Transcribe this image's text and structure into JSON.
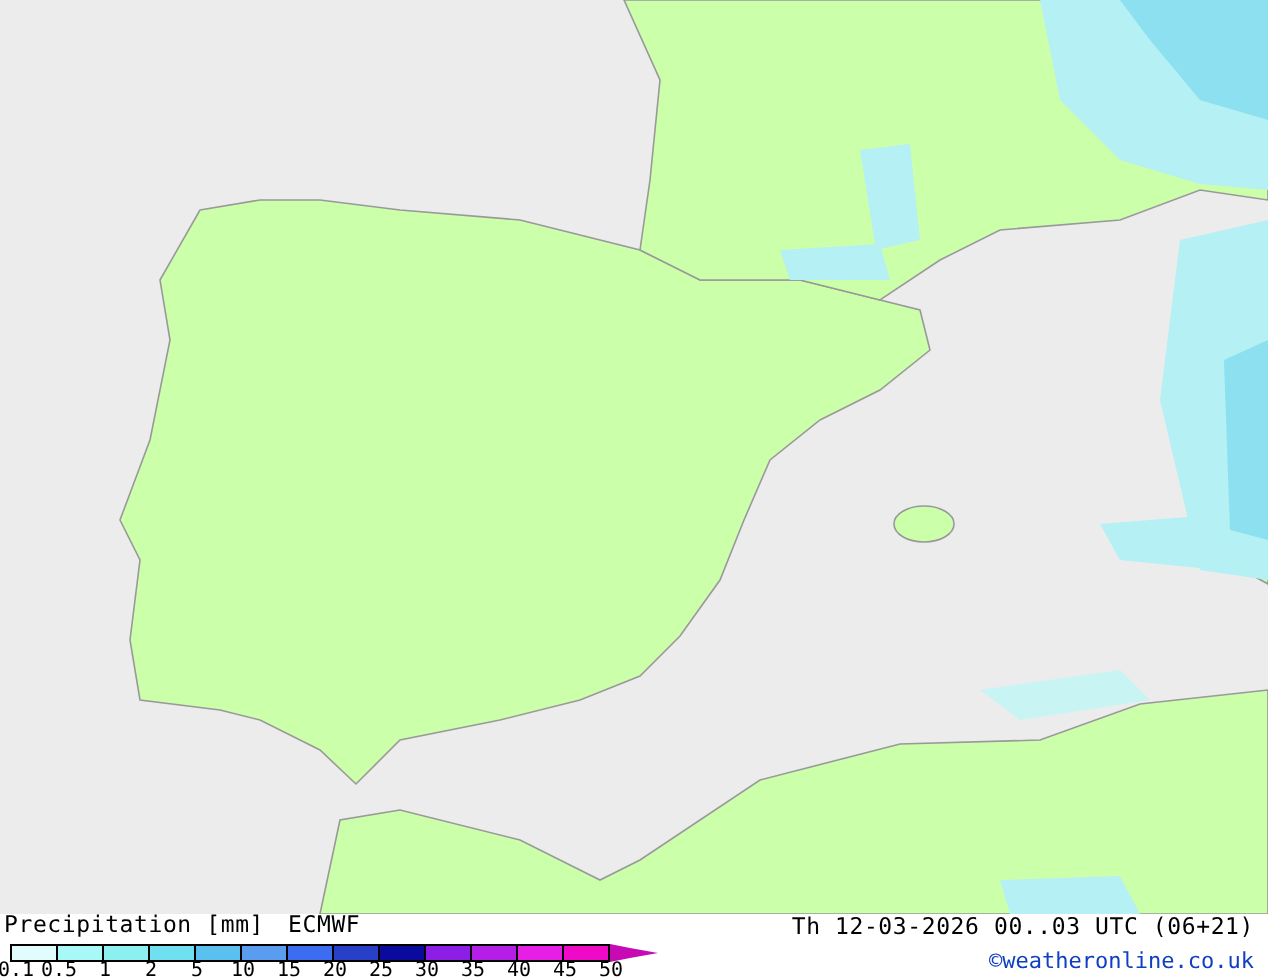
{
  "legend": {
    "title": "Precipitation [mm]",
    "model": "ECMWF",
    "bins": [
      {
        "color": "#e0fcfc"
      },
      {
        "color": "#a8f8f8"
      },
      {
        "color": "#8cf0f0"
      },
      {
        "color": "#6ee0f0"
      },
      {
        "color": "#5ac0f0"
      },
      {
        "color": "#5a9cf0"
      },
      {
        "color": "#3c6cf0"
      },
      {
        "color": "#2840c8"
      },
      {
        "color": "#0a0a9c"
      },
      {
        "color": "#8c1ee6"
      },
      {
        "color": "#b41ee6"
      },
      {
        "color": "#e61ee6"
      },
      {
        "color": "#f00ac8"
      },
      {
        "color": "#c80ab4"
      }
    ],
    "ticks": [
      "0.1",
      "0.5",
      "1",
      "2",
      "5",
      "10",
      "15",
      "20",
      "25",
      "30",
      "35",
      "40",
      "45",
      "50"
    ]
  },
  "valid_time": "Th 12-03-2026 00..03 UTC (06+21)",
  "credit": "©weatheronline.co.uk"
}
